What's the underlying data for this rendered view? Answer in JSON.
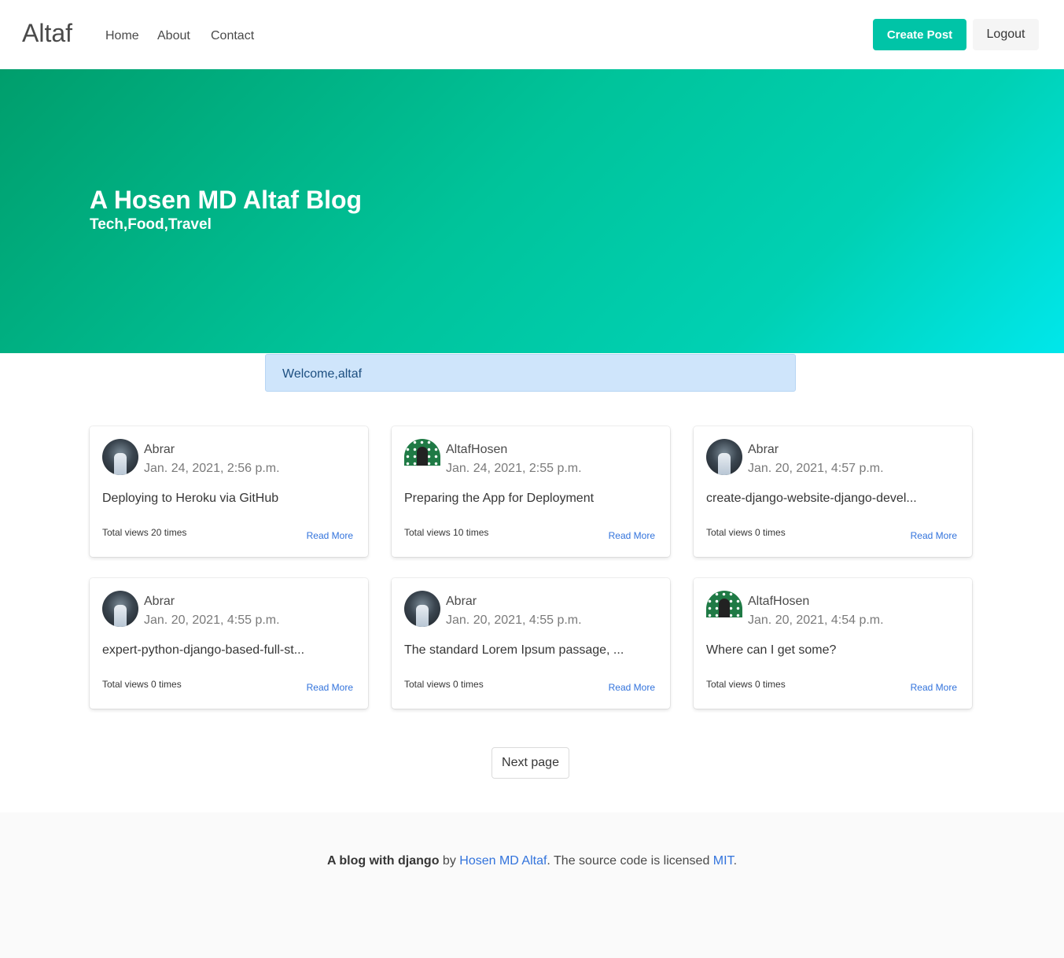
{
  "navbar": {
    "brand": "Altaf",
    "links": [
      "Home",
      "About",
      "Contact"
    ],
    "create_post_label": "Create Post",
    "logout_label": "Logout"
  },
  "hero": {
    "title": "A Hosen MD Altaf Blog",
    "subtitle": "Tech,Food,Travel"
  },
  "notice": "Welcome,altaf",
  "posts": [
    {
      "author": "Abrar",
      "avatar": "abrar-avatar",
      "date": "Jan. 24, 2021, 2:56 p.m.",
      "title": "Deploying to Heroku via GitHub",
      "views": "Total views 20 times",
      "read_more": "Read More"
    },
    {
      "author": "AltafHosen",
      "avatar": "altafhosen-avatar",
      "date": "Jan. 24, 2021, 2:55 p.m.",
      "title": "Preparing the App for Deployment",
      "views": "Total views 10 times",
      "read_more": "Read More"
    },
    {
      "author": "Abrar",
      "avatar": "abrar-avatar",
      "date": "Jan. 20, 2021, 4:57 p.m.",
      "title": "create-django-website-django-devel...",
      "views": "Total views 0 times",
      "read_more": "Read More"
    },
    {
      "author": "Abrar",
      "avatar": "abrar-avatar",
      "date": "Jan. 20, 2021, 4:55 p.m.",
      "title": "expert-python-django-based-full-st...",
      "views": "Total views 0 times",
      "read_more": "Read More"
    },
    {
      "author": "Abrar",
      "avatar": "abrar-avatar",
      "date": "Jan. 20, 2021, 4:55 p.m.",
      "title": "The standard Lorem Ipsum passage, ...",
      "views": "Total views 0 times",
      "read_more": "Read More"
    },
    {
      "author": "AltafHosen",
      "avatar": "altafhosen-avatar",
      "date": "Jan. 20, 2021, 4:54 p.m.",
      "title": "Where can I get some?",
      "views": "Total views 0 times",
      "read_more": "Read More"
    }
  ],
  "pagination": {
    "next_label": "Next page"
  },
  "footer": {
    "strong": "A blog with django",
    "by": " by ",
    "author_link": "Hosen MD Altaf",
    "middle": ". The source code is licensed ",
    "license_link": "MIT",
    "end": "."
  },
  "colors": {
    "primary": "#00c4a7",
    "link": "#3273dc",
    "notice_bg": "#cfe5fb",
    "hero_start": "#009e6c",
    "hero_end": "#00e7eb"
  }
}
